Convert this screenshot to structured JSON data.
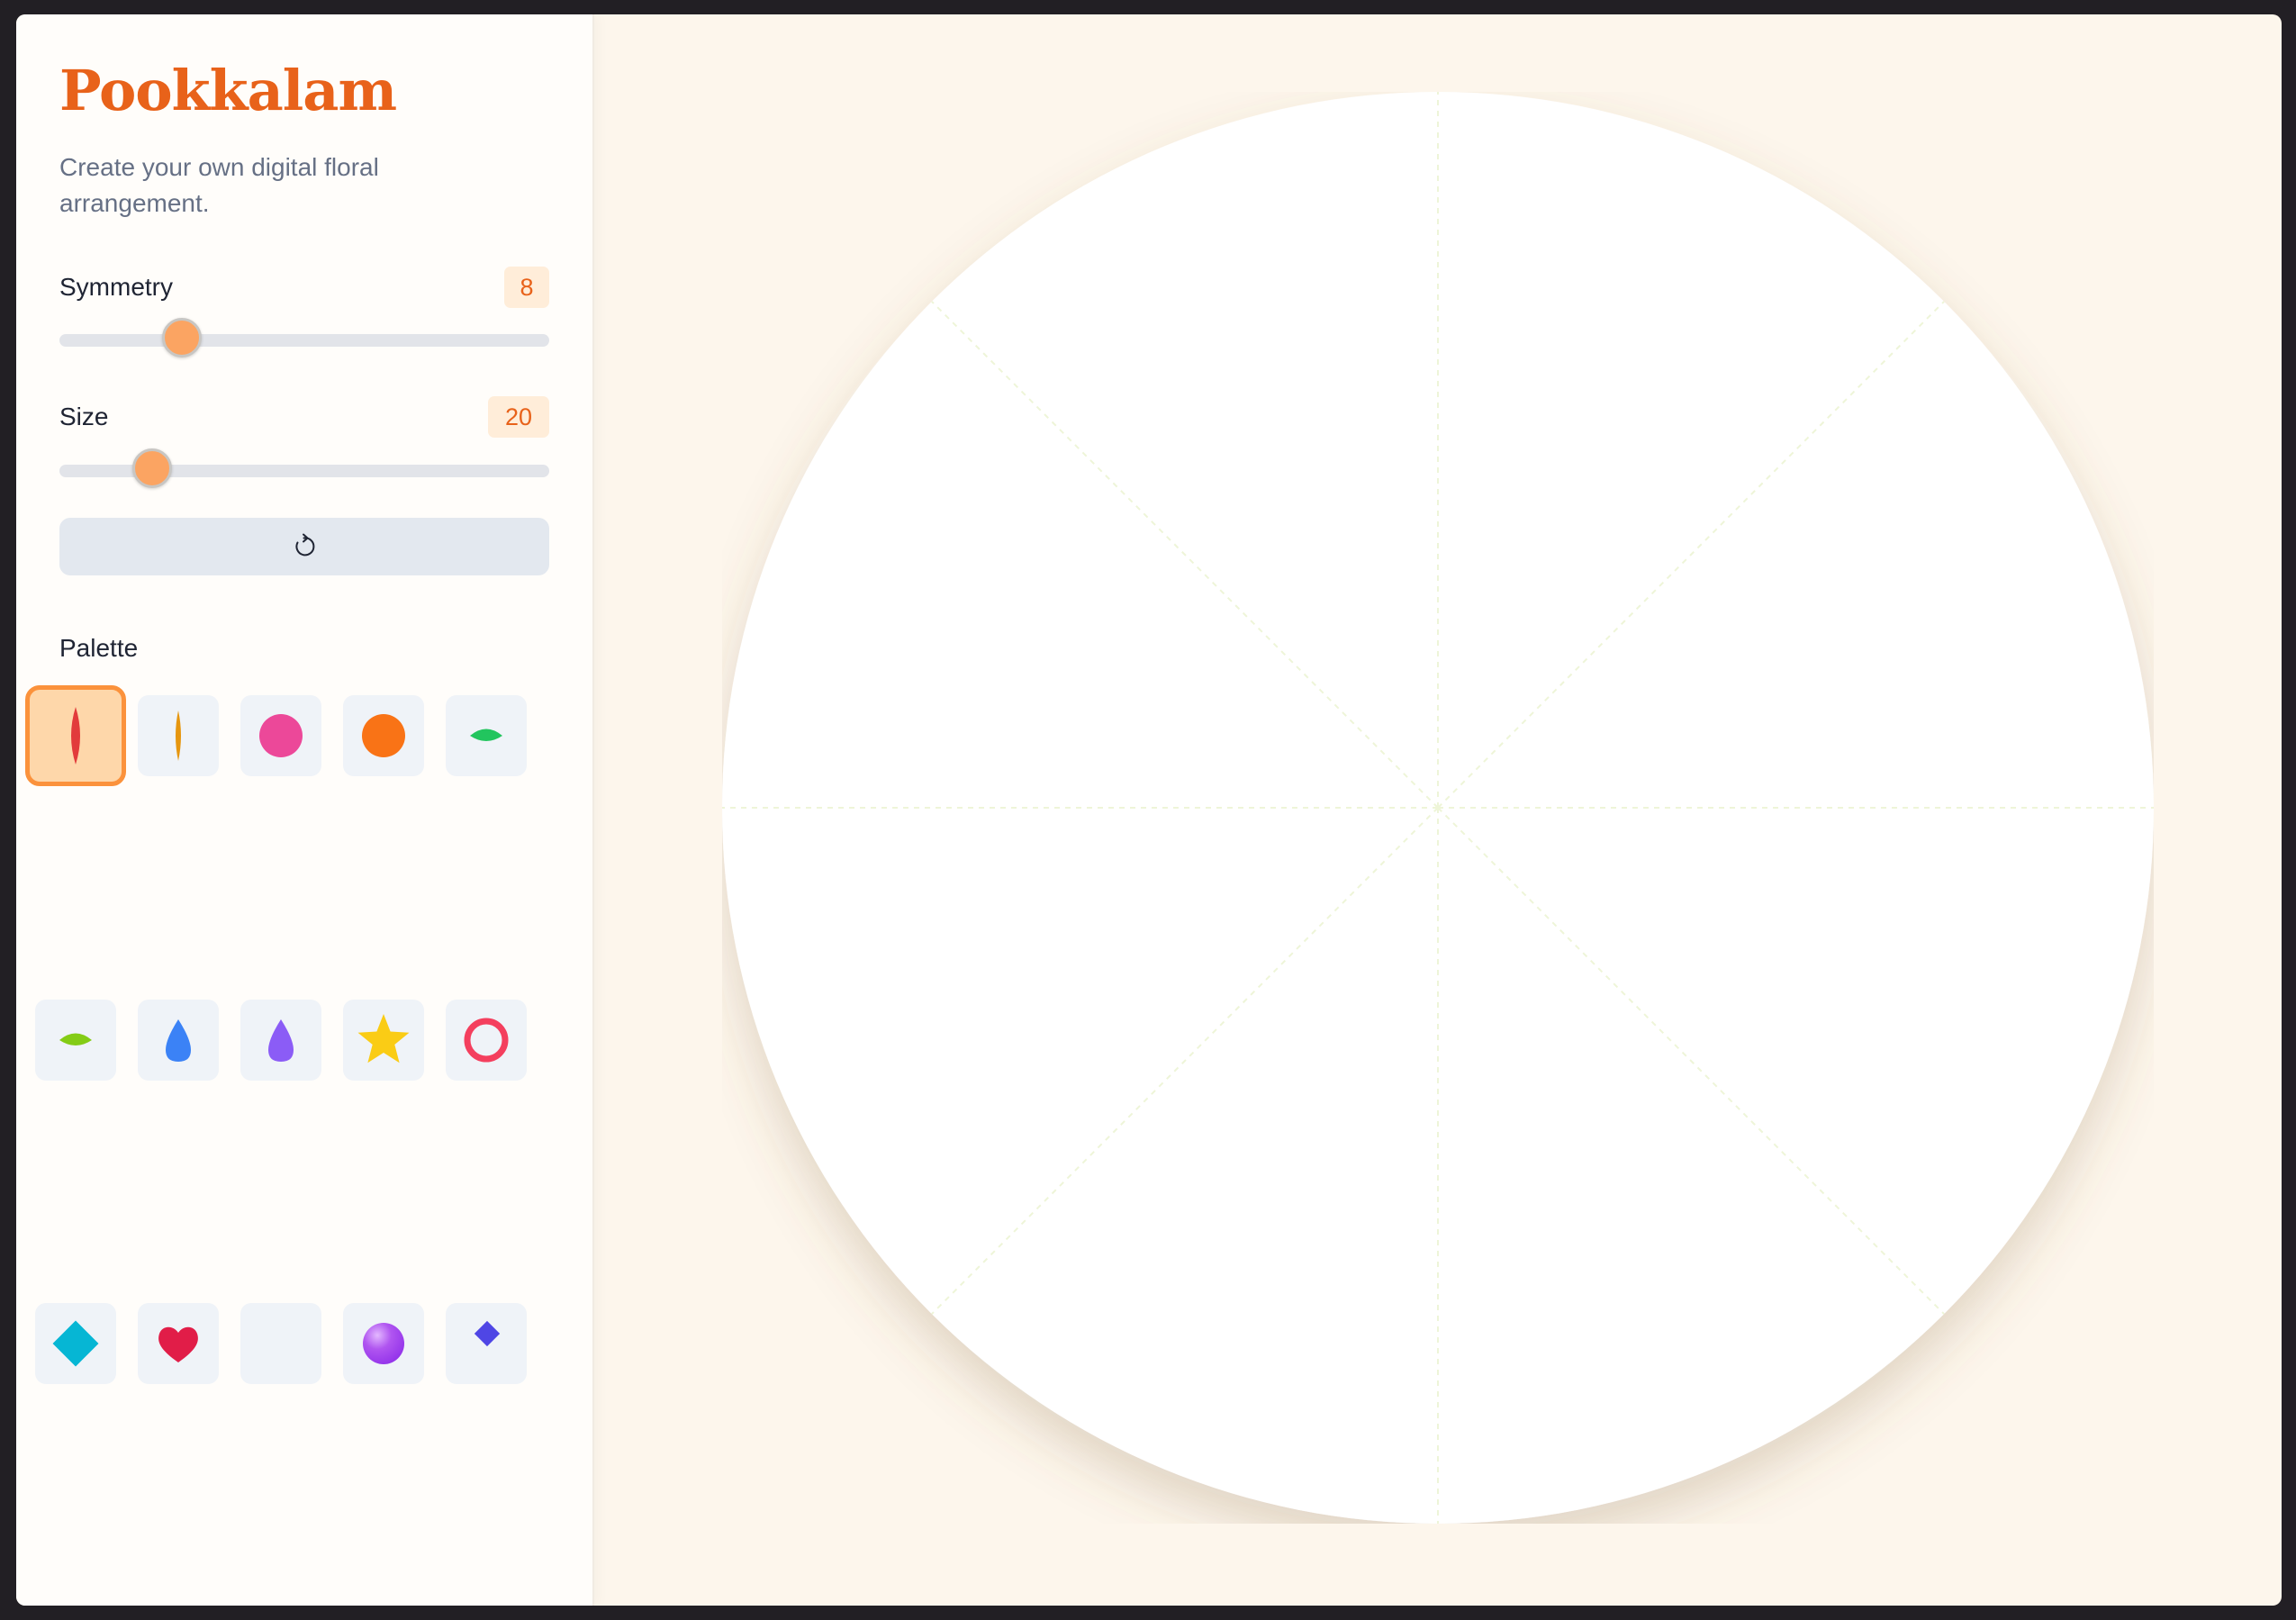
{
  "app": {
    "title": "Pookkalam",
    "subtitle": "Create your own digital floral arrangement."
  },
  "controls": {
    "symmetry": {
      "label": "Symmetry",
      "value": "8",
      "min": 2,
      "max": 24,
      "level": 0.25
    },
    "size": {
      "label": "Size",
      "value": "20",
      "min": 5,
      "max": 100,
      "level": 0.19
    },
    "reset_icon": "reset-icon"
  },
  "palette": {
    "label": "Palette",
    "selected_index": 0,
    "items": [
      {
        "name": "red-petal",
        "shape": "narrow-petal",
        "color": "#e23b3b"
      },
      {
        "name": "marigold-petal",
        "shape": "thin-petal",
        "color": "#e6960f"
      },
      {
        "name": "pink-dot",
        "shape": "circle",
        "color": "#ec4899"
      },
      {
        "name": "orange-dot",
        "shape": "circle",
        "color": "#f97316"
      },
      {
        "name": "green-leaf",
        "shape": "leaf",
        "color": "#22c55e"
      },
      {
        "name": "lime-leaf",
        "shape": "leaf",
        "color": "#84cc16"
      },
      {
        "name": "blue-drop",
        "shape": "drop",
        "color": "#3b82f6"
      },
      {
        "name": "violet-drop",
        "shape": "drop",
        "color": "#8b5cf6"
      },
      {
        "name": "yellow-star",
        "shape": "star",
        "color": "#facc15"
      },
      {
        "name": "rose-ring",
        "shape": "ring",
        "color": "#f43f5e"
      },
      {
        "name": "cyan-diamond",
        "shape": "diamond",
        "color": "#06b6d4"
      },
      {
        "name": "red-heart",
        "shape": "heart",
        "color": "#e11d48"
      },
      {
        "name": "empty-slot",
        "shape": "none",
        "color": "#eff3f8"
      },
      {
        "name": "purple-bead",
        "shape": "sphere",
        "color": "#9333ea"
      },
      {
        "name": "indigo-gem",
        "shape": "small-diamond",
        "color": "#4f46e5"
      }
    ]
  },
  "canvas": {
    "background": "#fdf6ec",
    "board_color": "#ffffff",
    "guide_color": "#eef5d8",
    "guide_lines": 8
  }
}
